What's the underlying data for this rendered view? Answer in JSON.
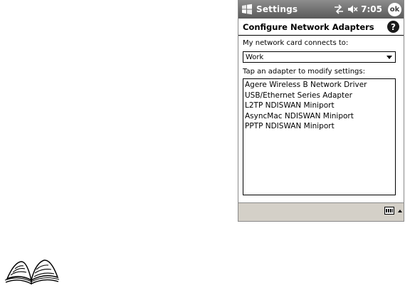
{
  "titlebar": {
    "app_title": "Settings",
    "time": "7:05",
    "ok_label": "ok",
    "icons": [
      "windows-flag-icon",
      "connectivity-icon",
      "speaker-muted-icon"
    ]
  },
  "page": {
    "title": "Configure Network Adapters",
    "help_label": "?"
  },
  "network": {
    "connects_label": "My network card connects to:",
    "selected": "Work"
  },
  "adapters": {
    "label": "Tap an adapter to modify settings:",
    "items": [
      "Agere Wireless B Network Driver",
      "USB/Ethernet Series Adapter",
      "L2TP NDISWAN Miniport",
      "AsyncMac NDISWAN Miniport",
      "PPTP NDISWAN Miniport"
    ]
  },
  "menubar": {
    "icons": [
      "keyboard-icon",
      "input-panel-arrow-icon"
    ]
  },
  "decoration": {
    "icon": "open-book-note-icon"
  },
  "colors": {
    "titlebar": "#5a5a5a",
    "menubar": "#d4d0c8"
  }
}
